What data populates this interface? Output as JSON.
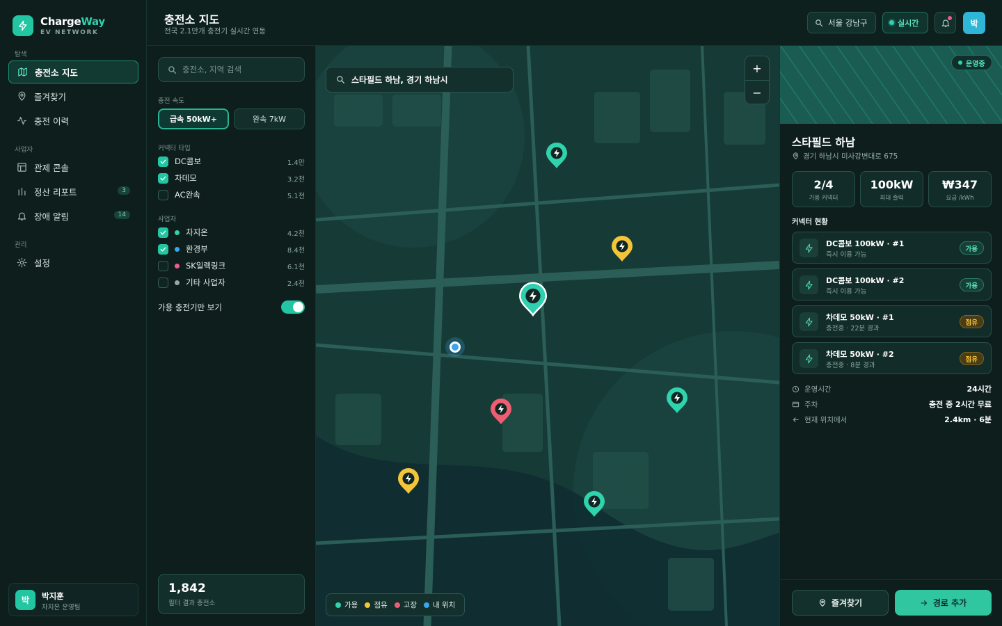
{
  "brand": {
    "name_part1": "Charge",
    "name_part2": "Way",
    "subtitle": "EV NETWORK"
  },
  "sidebar": {
    "sections": [
      {
        "label": "탐색",
        "items": [
          {
            "label": "충전소 지도",
            "icon": "map-icon",
            "active": true
          },
          {
            "label": "즐겨찾기",
            "icon": "pin-icon"
          },
          {
            "label": "충전 이력",
            "icon": "activity-icon"
          }
        ]
      },
      {
        "label": "사업자",
        "items": [
          {
            "label": "관제 콘솔",
            "icon": "layout-icon"
          },
          {
            "label": "정산 리포트",
            "icon": "bar-chart-icon",
            "badge": "3"
          },
          {
            "label": "장애 알림",
            "icon": "bell-icon",
            "badge": "14"
          }
        ]
      },
      {
        "label": "관리",
        "items": [
          {
            "label": "설정",
            "icon": "sun-gear-icon"
          }
        ]
      }
    ],
    "user": {
      "avatar": "박",
      "name": "박지훈",
      "role": "차지온 운영팀"
    }
  },
  "header": {
    "title": "충전소 지도",
    "subtitle": "전국 2.1만개 충전기 실시간 연동",
    "location_button": "서울 강남구",
    "live_label": "실시간",
    "avatar": "박"
  },
  "filters": {
    "search_placeholder": "충전소, 지역 검색",
    "speed_label": "충전 속도",
    "speed_fast": "급속 50kW+",
    "speed_slow": "완속 7kW",
    "connector_label": "커넥터 타입",
    "connectors": [
      {
        "label": "DC콤보",
        "count": "1.4만",
        "checked": true
      },
      {
        "label": "차데모",
        "count": "3.2천",
        "checked": true
      },
      {
        "label": "AC완속",
        "count": "5.1천",
        "checked": false
      }
    ],
    "operator_label": "사업자",
    "operators": [
      {
        "label": "차지온",
        "count": "4.2천",
        "checked": true,
        "color": "#2fd3ad"
      },
      {
        "label": "환경부",
        "count": "8.4천",
        "checked": true,
        "color": "#3aa6f0"
      },
      {
        "label": "SK일렉링크",
        "count": "6.1천",
        "checked": false,
        "color": "#ef5d8a"
      },
      {
        "label": "기타 사업자",
        "count": "2.4천",
        "checked": false,
        "color": "#98a8a4"
      }
    ],
    "available_only_label": "가용 충전기만 보기",
    "available_only": true,
    "result_count": "1,842",
    "result_label": "필터 결과 충전소"
  },
  "map": {
    "search_value": "스타필드 하남, 경기 하남시",
    "zoom_in": "+",
    "zoom_out": "−",
    "legend": [
      {
        "label": "가용",
        "color": "#2fd3ad"
      },
      {
        "label": "점유",
        "color": "#f3c53a"
      },
      {
        "label": "고장",
        "color": "#ef5d72"
      },
      {
        "label": "내 위치",
        "color": "#3aa6f0"
      }
    ]
  },
  "detail": {
    "status": "운영중",
    "name": "스타필드 하남",
    "address": "경기 하남시 미사강변대로 675",
    "stats": [
      {
        "value": "2/4",
        "label": "가용 커넥터"
      },
      {
        "value": "100kW",
        "label": "최대 출력"
      },
      {
        "value": "₩347",
        "label": "요금 /kWh"
      }
    ],
    "connectors_title": "커넥터 현황",
    "connectors": [
      {
        "name": "DC콤보 100kW · #1",
        "status": "즉시 이용 가능",
        "badge": "가용",
        "state": "avail"
      },
      {
        "name": "DC콤보 100kW · #2",
        "status": "즉시 이용 가능",
        "badge": "가용",
        "state": "avail"
      },
      {
        "name": "차데모 50kW · #1",
        "status": "충전중 · 22분 경과",
        "badge": "점유",
        "state": "occ"
      },
      {
        "name": "차데모 50kW · #2",
        "status": "충전중 · 8분 경과",
        "badge": "점유",
        "state": "occ"
      }
    ],
    "info": [
      {
        "label": "운영시간",
        "value": "24시간",
        "icon": "clock-icon"
      },
      {
        "label": "주차",
        "value": "충전 중 2시간 무료",
        "icon": "card-icon"
      },
      {
        "label": "현재 위치에서",
        "value": "2.4km · 6분",
        "icon": "arrow-left-icon"
      }
    ],
    "favorite_button": "즐겨찾기",
    "route_button": "경로 추가"
  },
  "colors": {
    "accent": "#23c6a2",
    "available": "#2fd3ad",
    "occupied": "#f3c53a",
    "broken": "#ef5d72",
    "my_location": "#3aa6f0"
  }
}
